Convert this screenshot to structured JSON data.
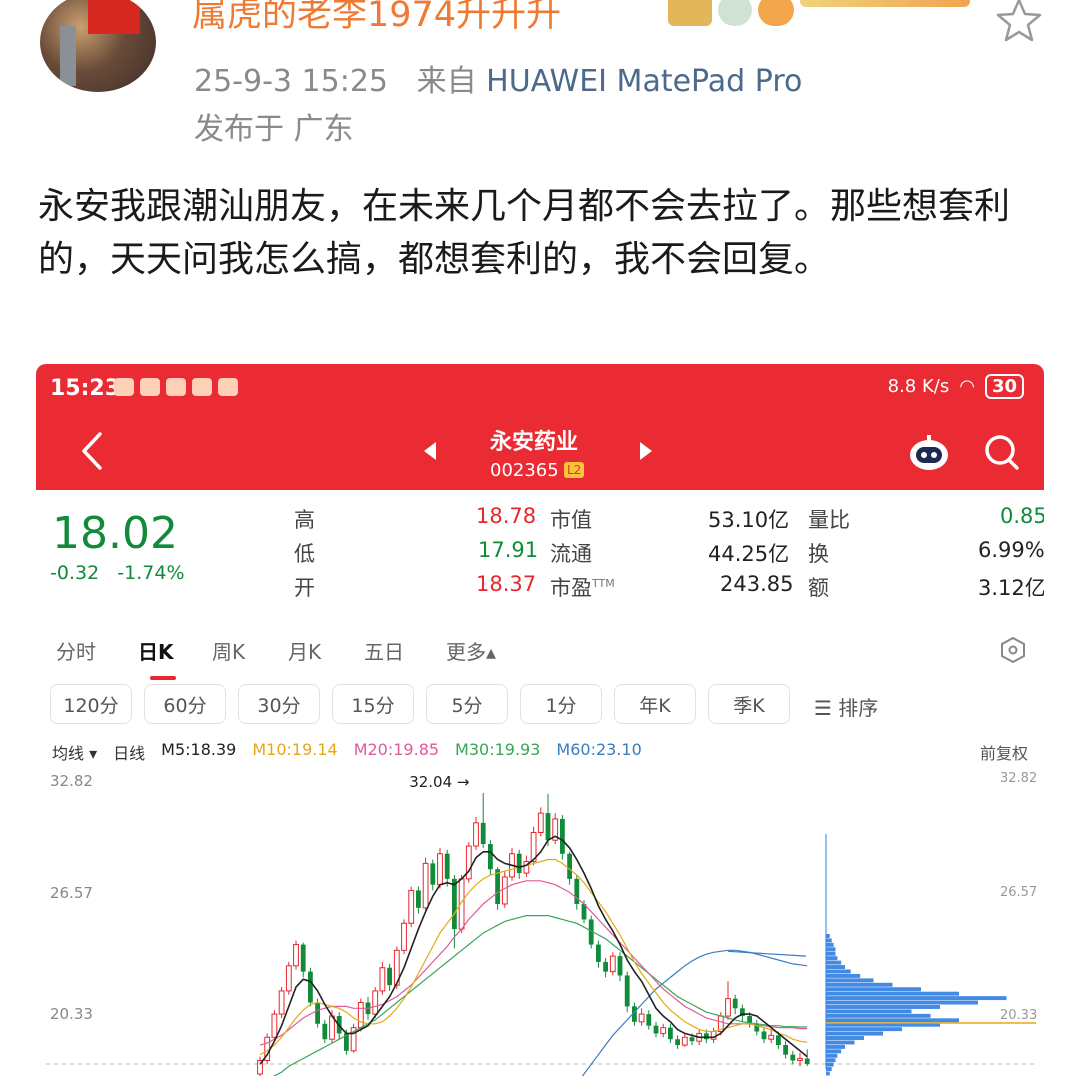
{
  "post": {
    "username": "属虎的老李1974升升升",
    "date": "25-9-3 15:25",
    "source_prefix": "来自",
    "device": "HUAWEI MatePad Pro",
    "location": "发布于 广东",
    "text": "永安我跟潮汕朋友，在未来几个月都不会去拉了。那些想套利的，天天问我怎么搞，都想套利的，我不会回复。"
  },
  "colors": {
    "red": "#ea2b34",
    "up": "#e8262e",
    "down": "#0f8b3a",
    "link": "#4c6a8c",
    "username": "#ef7a33"
  },
  "screenshot": {
    "status": {
      "time": "15:23",
      "net_speed": "8.8 K/s",
      "battery": "30"
    },
    "header": {
      "stock_name": "永安药业",
      "stock_code": "002365",
      "level": "L2"
    },
    "quote": {
      "price": "18.02",
      "change": "-0.32",
      "change_pct": "-1.74%",
      "rows": [
        {
          "k1": "高",
          "v1": "18.78",
          "k2": "市值",
          "v2": "53.10亿",
          "k3": "量比",
          "v3": "0.85"
        },
        {
          "k1": "低",
          "v1": "17.91",
          "k2": "流通",
          "v2": "44.25亿",
          "k3": "换",
          "v3": "6.99%"
        },
        {
          "k1": "开",
          "v1": "18.37",
          "k2": "市盈",
          "k2sup": "TTM",
          "v2": "243.85",
          "k3": "额",
          "v3": "3.12亿"
        }
      ]
    },
    "period_tabs": [
      "分时",
      "日K",
      "周K",
      "月K",
      "五日",
      "更多▴"
    ],
    "active_tab": "日K",
    "interval_pills": [
      "120分",
      "60分",
      "30分",
      "15分",
      "5分",
      "1分",
      "年K",
      "季K"
    ],
    "sort_label": "☰ 排序",
    "ma_legend": {
      "avg": "均线 ▾",
      "period": "日线",
      "items": [
        {
          "label": "M5:18.39",
          "color": "#222222"
        },
        {
          "label": "M10:19.14",
          "color": "#e6a817"
        },
        {
          "label": "M20:19.85",
          "color": "#e05a9b"
        },
        {
          "label": "M30:19.93",
          "color": "#3aa655"
        },
        {
          "label": "M60:23.10",
          "color": "#3a7bbf"
        }
      ]
    },
    "adjust_label": "前复权"
  },
  "chart_data": {
    "type": "candlestick",
    "y_ticks_left": [
      "32.82",
      "26.57",
      "20.33"
    ],
    "y_ticks_right": [
      "32.82",
      "26.57",
      "20.33"
    ],
    "ylim": [
      17.5,
      32.82
    ],
    "peak_label": "32.04 →",
    "peak_value": 32.04,
    "candles": [
      {
        "o": 17.5,
        "c": 18.2,
        "h": 18.4,
        "l": 17.3
      },
      {
        "o": 18.2,
        "c": 19.4,
        "h": 19.6,
        "l": 18.0
      },
      {
        "o": 19.4,
        "c": 20.6,
        "h": 20.8,
        "l": 19.2
      },
      {
        "o": 20.6,
        "c": 21.8,
        "h": 22.0,
        "l": 20.4
      },
      {
        "o": 21.8,
        "c": 23.1,
        "h": 23.3,
        "l": 21.6
      },
      {
        "o": 23.1,
        "c": 24.2,
        "h": 24.4,
        "l": 22.9
      },
      {
        "o": 24.2,
        "c": 22.8,
        "h": 24.3,
        "l": 22.5
      },
      {
        "o": 22.8,
        "c": 21.2,
        "h": 23.0,
        "l": 21.0
      },
      {
        "o": 21.2,
        "c": 20.1,
        "h": 21.4,
        "l": 19.9
      },
      {
        "o": 20.1,
        "c": 19.3,
        "h": 20.3,
        "l": 19.1
      },
      {
        "o": 19.3,
        "c": 20.5,
        "h": 20.8,
        "l": 19.1
      },
      {
        "o": 20.5,
        "c": 19.6,
        "h": 20.7,
        "l": 19.3
      },
      {
        "o": 19.6,
        "c": 18.7,
        "h": 19.8,
        "l": 18.5
      },
      {
        "o": 18.7,
        "c": 19.9,
        "h": 20.1,
        "l": 18.6
      },
      {
        "o": 19.9,
        "c": 21.2,
        "h": 21.4,
        "l": 19.7
      },
      {
        "o": 21.2,
        "c": 20.6,
        "h": 21.5,
        "l": 20.3
      },
      {
        "o": 20.6,
        "c": 21.8,
        "h": 22.0,
        "l": 20.4
      },
      {
        "o": 21.8,
        "c": 23.0,
        "h": 23.3,
        "l": 21.6
      },
      {
        "o": 23.0,
        "c": 22.1,
        "h": 23.2,
        "l": 21.8
      },
      {
        "o": 22.1,
        "c": 23.9,
        "h": 24.1,
        "l": 21.9
      },
      {
        "o": 23.9,
        "c": 25.3,
        "h": 25.5,
        "l": 23.7
      },
      {
        "o": 25.3,
        "c": 27.0,
        "h": 27.2,
        "l": 25.1
      },
      {
        "o": 27.0,
        "c": 26.1,
        "h": 27.2,
        "l": 25.8
      },
      {
        "o": 26.1,
        "c": 28.4,
        "h": 28.7,
        "l": 25.9
      },
      {
        "o": 28.4,
        "c": 27.3,
        "h": 28.6,
        "l": 27.0
      },
      {
        "o": 27.3,
        "c": 28.9,
        "h": 29.2,
        "l": 27.1
      },
      {
        "o": 28.9,
        "c": 27.6,
        "h": 29.1,
        "l": 27.2
      },
      {
        "o": 27.6,
        "c": 25.0,
        "h": 27.8,
        "l": 24.0
      },
      {
        "o": 25.0,
        "c": 27.6,
        "h": 27.8,
        "l": 24.8
      },
      {
        "o": 27.6,
        "c": 29.3,
        "h": 29.5,
        "l": 27.4
      },
      {
        "o": 29.3,
        "c": 30.5,
        "h": 30.8,
        "l": 29.1
      },
      {
        "o": 30.5,
        "c": 29.4,
        "h": 32.04,
        "l": 29.2
      },
      {
        "o": 29.4,
        "c": 28.1,
        "h": 29.6,
        "l": 27.8
      },
      {
        "o": 28.1,
        "c": 26.3,
        "h": 28.2,
        "l": 26.0
      },
      {
        "o": 26.3,
        "c": 27.7,
        "h": 28.0,
        "l": 26.1
      },
      {
        "o": 27.7,
        "c": 28.9,
        "h": 29.2,
        "l": 27.5
      },
      {
        "o": 28.9,
        "c": 27.9,
        "h": 29.1,
        "l": 27.6
      },
      {
        "o": 27.9,
        "c": 28.5,
        "h": 28.8,
        "l": 27.7
      },
      {
        "o": 28.5,
        "c": 30.0,
        "h": 30.3,
        "l": 28.3
      },
      {
        "o": 30.0,
        "c": 31.0,
        "h": 31.3,
        "l": 29.8
      },
      {
        "o": 31.0,
        "c": 29.6,
        "h": 32.0,
        "l": 29.3
      },
      {
        "o": 29.6,
        "c": 30.7,
        "h": 31.0,
        "l": 29.4
      },
      {
        "o": 30.7,
        "c": 28.9,
        "h": 30.9,
        "l": 28.6
      },
      {
        "o": 28.9,
        "c": 27.6,
        "h": 29.0,
        "l": 27.3
      },
      {
        "o": 27.6,
        "c": 26.3,
        "h": 27.8,
        "l": 26.0
      },
      {
        "o": 26.3,
        "c": 25.5,
        "h": 26.5,
        "l": 25.3
      },
      {
        "o": 25.5,
        "c": 24.2,
        "h": 25.7,
        "l": 24.0
      },
      {
        "o": 24.2,
        "c": 23.3,
        "h": 24.4,
        "l": 23.0
      },
      {
        "o": 23.3,
        "c": 22.8,
        "h": 23.5,
        "l": 22.5
      },
      {
        "o": 22.8,
        "c": 23.6,
        "h": 23.8,
        "l": 22.6
      },
      {
        "o": 23.6,
        "c": 22.6,
        "h": 23.8,
        "l": 22.3
      },
      {
        "o": 22.6,
        "c": 21.0,
        "h": 22.8,
        "l": 20.7
      },
      {
        "o": 21.0,
        "c": 20.2,
        "h": 21.2,
        "l": 20.0
      },
      {
        "o": 20.2,
        "c": 20.6,
        "h": 20.9,
        "l": 20.0
      },
      {
        "o": 20.6,
        "c": 20.0,
        "h": 20.8,
        "l": 19.8
      },
      {
        "o": 20.0,
        "c": 19.6,
        "h": 20.2,
        "l": 19.4
      },
      {
        "o": 19.6,
        "c": 19.9,
        "h": 20.1,
        "l": 19.4
      },
      {
        "o": 19.9,
        "c": 19.3,
        "h": 20.1,
        "l": 19.1
      },
      {
        "o": 19.3,
        "c": 19.0,
        "h": 19.5,
        "l": 18.8
      },
      {
        "o": 19.0,
        "c": 19.4,
        "h": 19.6,
        "l": 18.9
      },
      {
        "o": 19.4,
        "c": 19.2,
        "h": 19.6,
        "l": 19.0
      },
      {
        "o": 19.2,
        "c": 19.6,
        "h": 19.8,
        "l": 19.0
      },
      {
        "o": 19.6,
        "c": 19.3,
        "h": 19.8,
        "l": 19.1
      },
      {
        "o": 19.3,
        "c": 19.7,
        "h": 19.9,
        "l": 19.1
      },
      {
        "o": 19.7,
        "c": 20.5,
        "h": 20.7,
        "l": 19.5
      },
      {
        "o": 20.5,
        "c": 21.4,
        "h": 22.3,
        "l": 20.3
      },
      {
        "o": 21.4,
        "c": 20.9,
        "h": 21.6,
        "l": 20.6
      },
      {
        "o": 20.9,
        "c": 20.5,
        "h": 21.1,
        "l": 20.2
      },
      {
        "o": 20.5,
        "c": 20.1,
        "h": 20.7,
        "l": 19.9
      },
      {
        "o": 20.1,
        "c": 19.7,
        "h": 20.3,
        "l": 19.5
      },
      {
        "o": 19.7,
        "c": 19.3,
        "h": 19.9,
        "l": 19.1
      },
      {
        "o": 19.3,
        "c": 19.5,
        "h": 19.8,
        "l": 19.1
      },
      {
        "o": 19.5,
        "c": 19.0,
        "h": 19.7,
        "l": 18.8
      },
      {
        "o": 19.0,
        "c": 18.5,
        "h": 19.2,
        "l": 18.3
      },
      {
        "o": 18.5,
        "c": 18.2,
        "h": 18.7,
        "l": 18.0
      },
      {
        "o": 18.2,
        "c": 18.3,
        "h": 18.6,
        "l": 17.9
      },
      {
        "o": 18.3,
        "c": 18.02,
        "h": 18.78,
        "l": 17.91
      }
    ],
    "ma5": [
      18.0,
      18.5,
      19.2,
      20.0,
      21.0,
      22.0,
      22.4,
      22.3,
      21.8,
      21.1,
      20.5,
      20.0,
      19.6,
      19.6,
      19.8,
      20.0,
      20.5,
      21.0,
      21.5,
      22.2,
      23.0,
      24.0,
      25.0,
      25.9,
      26.7,
      27.3,
      27.4,
      27.3,
      27.6,
      28.0,
      28.7,
      29.0,
      29.0,
      28.6,
      28.4,
      28.3,
      28.2,
      28.3,
      28.6,
      29.0,
      29.6,
      29.8,
      29.6,
      29.2,
      28.6,
      27.9,
      27.1,
      26.2,
      25.5,
      24.9,
      24.2,
      23.4,
      22.8,
      22.3,
      21.6,
      20.9,
      20.5,
      20.2,
      19.8,
      19.6,
      19.5,
      19.4,
      19.4,
      19.4,
      19.6,
      20.0,
      20.4,
      20.6,
      20.6,
      20.5,
      20.2,
      19.9,
      19.6,
      19.3,
      19.0,
      18.7,
      18.39
    ],
    "ma10": [
      18.5,
      18.7,
      19.0,
      19.4,
      19.9,
      20.4,
      20.8,
      21.1,
      21.2,
      21.1,
      21.0,
      20.9,
      20.7,
      20.4,
      20.2,
      20.1,
      20.1,
      20.2,
      20.5,
      20.9,
      21.4,
      22.0,
      22.7,
      23.4,
      24.1,
      24.8,
      25.3,
      25.8,
      26.4,
      26.9,
      27.3,
      27.6,
      27.8,
      27.9,
      28.0,
      28.1,
      28.2,
      28.3,
      28.4,
      28.5,
      28.6,
      28.6,
      28.4,
      28.1,
      27.8,
      27.4,
      26.9,
      26.4,
      25.9,
      25.3,
      24.7,
      24.0,
      23.3,
      22.7,
      22.2,
      21.7,
      21.2,
      20.8,
      20.5,
      20.2,
      20.0,
      19.8,
      19.7,
      19.7,
      19.8,
      19.9,
      20.0,
      20.1,
      20.1,
      20.0,
      19.9,
      19.8,
      19.6,
      19.5,
      19.3,
      19.2,
      19.14
    ],
    "ma20": [
      19.0,
      19.1,
      19.3,
      19.5,
      19.8,
      20.1,
      20.4,
      20.6,
      20.8,
      20.9,
      21.0,
      21.0,
      21.0,
      20.9,
      20.9,
      20.9,
      21.0,
      21.1,
      21.3,
      21.5,
      21.8,
      22.1,
      22.5,
      22.9,
      23.3,
      23.7,
      24.1,
      24.6,
      25.0,
      25.5,
      25.9,
      26.3,
      26.6,
      26.9,
      27.1,
      27.3,
      27.4,
      27.5,
      27.5,
      27.5,
      27.4,
      27.3,
      27.1,
      26.9,
      26.6,
      26.3,
      25.9,
      25.5,
      25.1,
      24.7,
      24.3,
      23.9,
      23.5,
      23.1,
      22.7,
      22.3,
      21.9,
      21.6,
      21.3,
      21.0,
      20.8,
      20.6,
      20.4,
      20.3,
      20.2,
      20.1,
      20.1,
      20.1,
      20.1,
      20.0,
      20.0,
      19.95,
      19.9,
      19.9,
      19.9,
      19.85,
      19.85
    ],
    "ma30": [
      17.0,
      17.2,
      17.4,
      17.6,
      17.9,
      18.1,
      18.3,
      18.5,
      18.7,
      18.9,
      19.1,
      19.3,
      19.5,
      19.7,
      19.9,
      20.1,
      20.3,
      20.6,
      20.9,
      21.2,
      21.5,
      21.8,
      22.1,
      22.4,
      22.7,
      23.0,
      23.3,
      23.6,
      23.9,
      24.2,
      24.5,
      24.8,
      25.0,
      25.2,
      25.4,
      25.5,
      25.6,
      25.7,
      25.7,
      25.7,
      25.7,
      25.6,
      25.5,
      25.4,
      25.3,
      25.1,
      24.9,
      24.7,
      24.5,
      24.2,
      23.9,
      23.6,
      23.3,
      23.0,
      22.7,
      22.4,
      22.1,
      21.8,
      21.5,
      21.3,
      21.1,
      20.9,
      20.7,
      20.6,
      20.5,
      20.4,
      20.3,
      20.2,
      20.15,
      20.1,
      20.05,
      20.0,
      20.0,
      19.95,
      19.95,
      19.93,
      19.93
    ],
    "ma60": [
      null,
      null,
      null,
      null,
      null,
      null,
      null,
      null,
      null,
      null,
      null,
      null,
      null,
      null,
      null,
      null,
      null,
      null,
      null,
      null,
      null,
      null,
      null,
      null,
      null,
      null,
      null,
      null,
      null,
      null,
      null,
      null,
      null,
      null,
      null,
      null,
      null,
      null,
      null,
      null,
      null,
      null,
      16.0,
      16.5,
      17.0,
      17.5,
      18.0,
      18.5,
      19.0,
      19.5,
      19.9,
      20.3,
      20.7,
      21.1,
      21.5,
      21.9,
      22.2,
      22.5,
      22.8,
      23.1,
      23.35,
      23.55,
      23.7,
      23.8,
      23.85,
      23.9,
      23.9,
      23.85,
      23.8,
      23.7,
      23.6,
      23.5,
      23.4,
      23.3,
      23.2,
      23.15,
      23.1
    ],
    "volume_profile_note": "",
    "volume_profile": [
      0.02,
      0.03,
      0.04,
      0.05,
      0.05,
      0.06,
      0.08,
      0.1,
      0.13,
      0.18,
      0.25,
      0.35,
      0.5,
      0.7,
      0.95,
      0.8,
      0.6,
      0.45,
      0.55,
      0.7,
      0.6,
      0.4,
      0.3,
      0.2,
      0.15,
      0.1,
      0.08,
      0.06,
      0.05,
      0.04,
      0.03,
      0.02
    ]
  }
}
